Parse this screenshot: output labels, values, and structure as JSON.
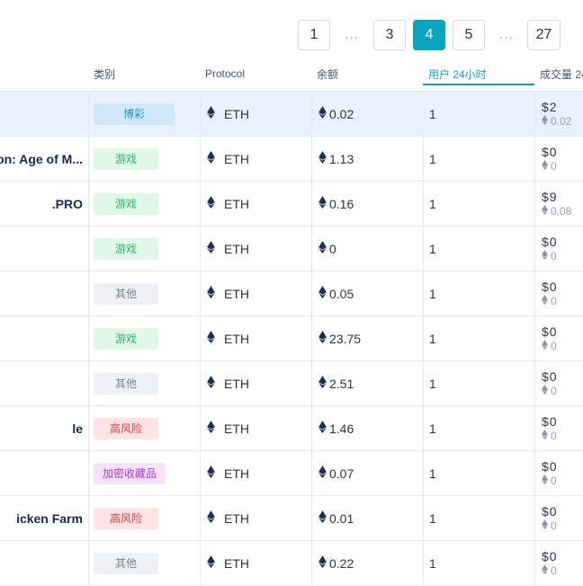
{
  "pagination": {
    "pages": [
      "1",
      "4",
      "5",
      "27"
    ],
    "ellipsis": "...",
    "page_3": "3",
    "active": "4"
  },
  "columns": {
    "category": "类别",
    "protocol": "Protocol",
    "balance": "余额",
    "users_24h": "用户 24小时",
    "volume": "成交量 24"
  },
  "colors": {
    "accent": "#0aa5bf",
    "selected_row": "#eaf1fe",
    "gambling": "#2d8fc6",
    "games": "#2db767",
    "other": "#7a8494",
    "high_risk": "#e0383d",
    "collectibles": "#b03ac8"
  },
  "icons": {
    "eth": "ethereum-icon"
  },
  "rows": [
    {
      "name": "",
      "category": "博彩",
      "protocol": "ETH",
      "balance": "0.02",
      "users": "1",
      "volume_usd": "$2",
      "volume_eth": "0.02"
    },
    {
      "name": "on: Age of M...",
      "category": "游戏",
      "protocol": "ETH",
      "balance": "1.13",
      "users": "1",
      "volume_usd": "$0",
      "volume_eth": "0"
    },
    {
      "name": ".PRO",
      "category": "游戏",
      "protocol": "ETH",
      "balance": "0.16",
      "users": "1",
      "volume_usd": "$9",
      "volume_eth": "0.08"
    },
    {
      "name": "",
      "category": "游戏",
      "protocol": "ETH",
      "balance": "0",
      "users": "1",
      "volume_usd": "$0",
      "volume_eth": "0"
    },
    {
      "name": "",
      "category": "其他",
      "protocol": "ETH",
      "balance": "0.05",
      "users": "1",
      "volume_usd": "$0",
      "volume_eth": "0"
    },
    {
      "name": "",
      "category": "游戏",
      "protocol": "ETH",
      "balance": "23.75",
      "users": "1",
      "volume_usd": "$0",
      "volume_eth": "0"
    },
    {
      "name": "",
      "category": "其他",
      "protocol": "ETH",
      "balance": "2.51",
      "users": "1",
      "volume_usd": "$0",
      "volume_eth": "0"
    },
    {
      "name": "le",
      "category": "高风险",
      "protocol": "ETH",
      "balance": "1.46",
      "users": "1",
      "volume_usd": "$0",
      "volume_eth": "0"
    },
    {
      "name": "",
      "category": "加密收藏品",
      "protocol": "ETH",
      "balance": "0.07",
      "users": "1",
      "volume_usd": "$0",
      "volume_eth": "0"
    },
    {
      "name": "icken Farm",
      "category": "高风险",
      "protocol": "ETH",
      "balance": "0.01",
      "users": "1",
      "volume_usd": "$0",
      "volume_eth": "0"
    },
    {
      "name": "",
      "category": "其他",
      "protocol": "ETH",
      "balance": "0.22",
      "users": "1",
      "volume_usd": "$0",
      "volume_eth": "0"
    }
  ]
}
